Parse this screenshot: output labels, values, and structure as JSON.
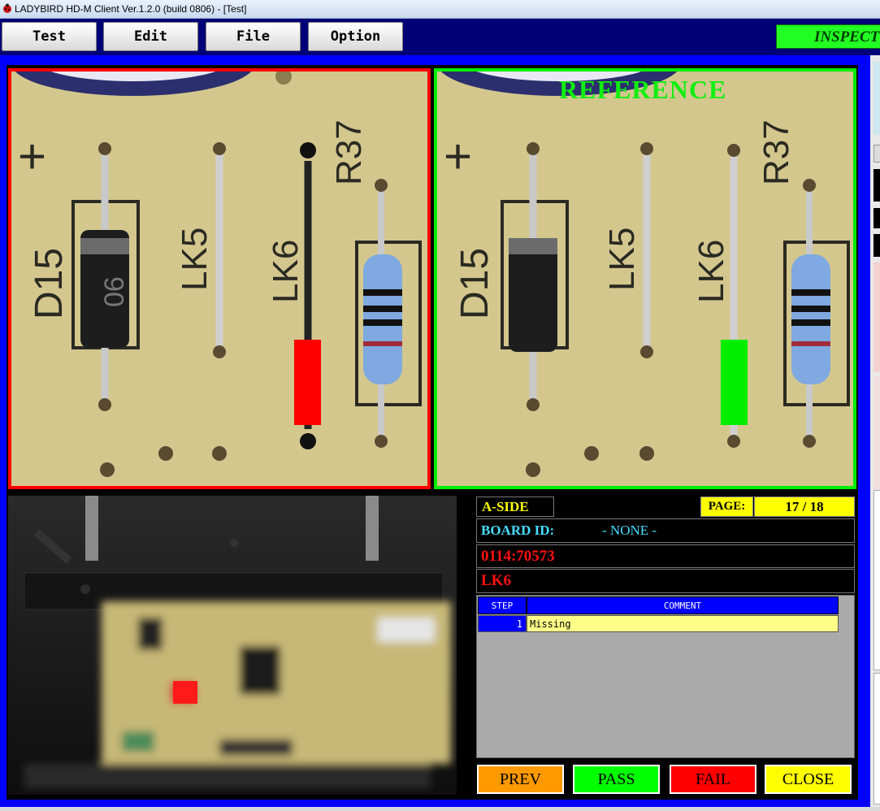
{
  "window": {
    "title": "LADYBIRD HD-M Client Ver.1.2.0  (build 0806) - [Test]"
  },
  "menu": {
    "test": "Test",
    "edit": "Edit",
    "file": "File",
    "option": "Option"
  },
  "status": {
    "mode": "INSPECT"
  },
  "reference_label": "REFERENCE",
  "silkscreen": {
    "diode": "D15",
    "diode_mark": "06",
    "link_left": "LK5",
    "link_right": "LK6",
    "resistor": "R37"
  },
  "info": {
    "side": "A-SIDE",
    "page_label": "PAGE:",
    "page_value": "17 / 18",
    "board_id_label": "BOARD ID:",
    "board_id_value": "- NONE -",
    "serial": "0114:70573",
    "part": "LK6"
  },
  "table": {
    "headers": [
      "STEP",
      "COMMENT"
    ],
    "rows": [
      {
        "step": "1",
        "comment": "Missing"
      }
    ]
  },
  "actions": {
    "prev": "PREV",
    "pass": "PASS",
    "fail": "FAIL",
    "close": "CLOSE"
  },
  "colors": {
    "frame": "#0000ff",
    "fail": "#ff0000",
    "pass": "#00ee00",
    "warning": "#ffff00",
    "prev": "#ff9900"
  }
}
